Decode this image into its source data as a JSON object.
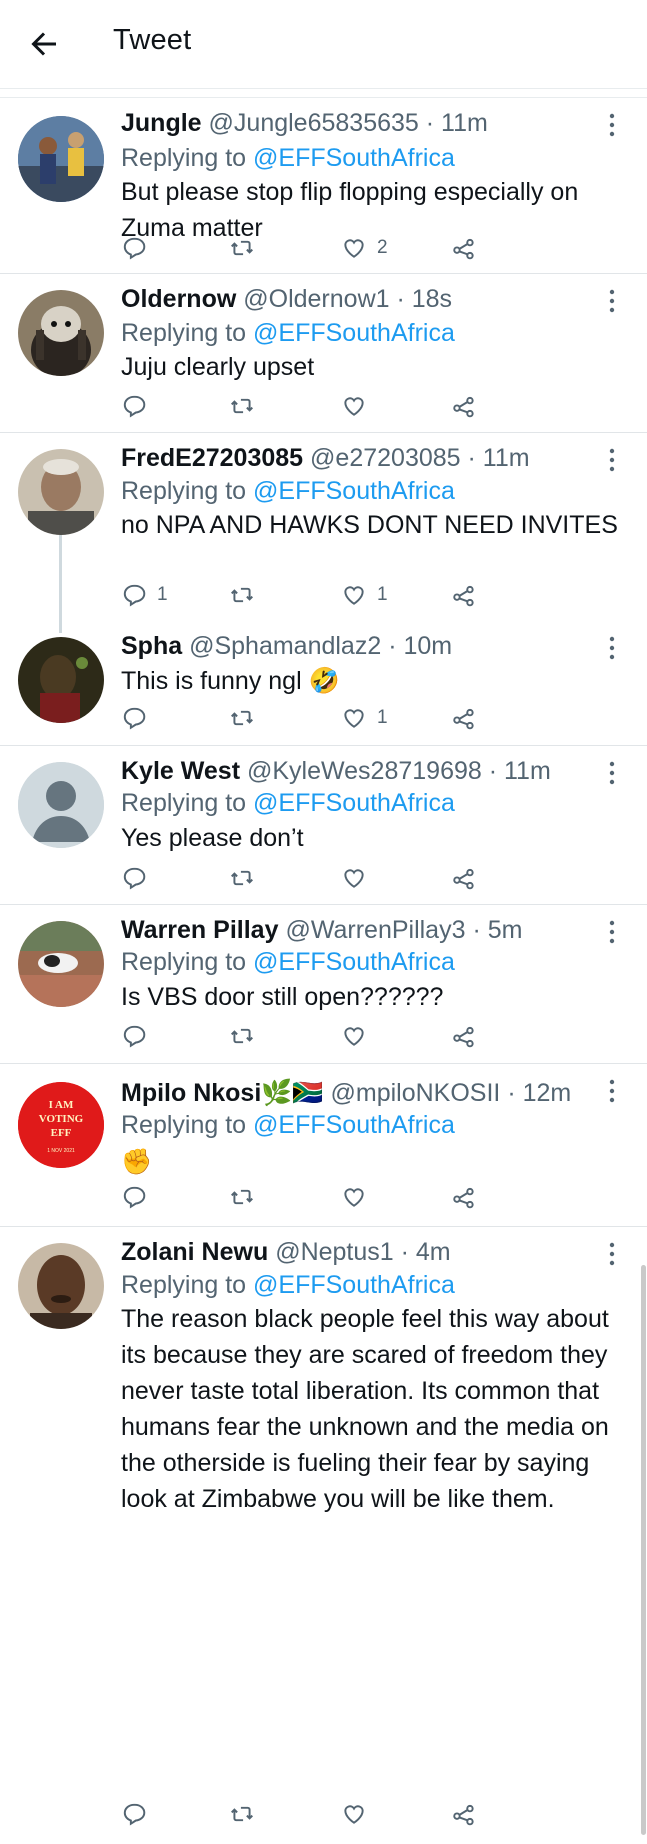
{
  "header": {
    "title": "Tweet"
  },
  "tweets": [
    {
      "name": "Jungle",
      "handle": "@Jungle65835635",
      "sep": " · ",
      "time": "11m",
      "replying_prefix": "Replying to ",
      "replying_to": "@EFFSouthAfrica",
      "text": "But please stop flip flopping especially on Zuma matter",
      "replies": "",
      "retweets": "",
      "likes": "2"
    },
    {
      "name": "Oldernow",
      "handle": "@Oldernow1",
      "sep": " · ",
      "time": "18s",
      "replying_prefix": "Replying to ",
      "replying_to": "@EFFSouthAfrica",
      "text": "Juju clearly upset",
      "replies": "",
      "retweets": "",
      "likes": ""
    },
    {
      "name": "FredE27203085",
      "handle": "@e27203085",
      "sep": " · ",
      "time": "11m",
      "replying_prefix": "Replying to ",
      "replying_to": "@EFFSouthAfrica",
      "text": "no NPA AND HAWKS DONT NEED INVITES",
      "replies": "1",
      "retweets": "",
      "likes": "1"
    },
    {
      "name": "Spha",
      "handle": "@Sphamandlaz2",
      "sep": " · ",
      "time": "10m",
      "replying_prefix": "",
      "replying_to": "",
      "text": "This is funny ngl 🤣",
      "replies": "",
      "retweets": "",
      "likes": "1"
    },
    {
      "name": "Kyle West",
      "handle": "@KyleWes28719698",
      "sep": " · ",
      "time": "11m",
      "replying_prefix": "Replying to ",
      "replying_to": "@EFFSouthAfrica",
      "text": "Yes please don’t",
      "replies": "",
      "retweets": "",
      "likes": ""
    },
    {
      "name": "Warren Pillay",
      "handle": "@WarrenPillay3",
      "sep": " · ",
      "time": "5m",
      "replying_prefix": "Replying to ",
      "replying_to": "@EFFSouthAfrica",
      "text": "Is VBS door still open??????",
      "replies": "",
      "retweets": "",
      "likes": ""
    },
    {
      "name": "Mpilo Nkosi🌿🇿🇦",
      "handle": "@mpiloNKOSII",
      "sep": " · ",
      "time": "12m",
      "replying_prefix": "Replying to ",
      "replying_to": "@EFFSouthAfrica",
      "text": "✊",
      "replies": "",
      "retweets": "",
      "likes": "",
      "avatar_text": [
        "I AM",
        "VOTING",
        "EFF",
        "1 NOV 2021"
      ]
    },
    {
      "name": "Zolani Newu",
      "handle": "@Neptus1",
      "sep": " · ",
      "time": "4m",
      "replying_prefix": "Replying to ",
      "replying_to": "@EFFSouthAfrica",
      "text": "The reason black people feel this way about its because they are scared of freedom they never taste total liberation. Its common that humans fear the unknown and the media on the otherside is fueling their fear by saying look at Zimbabwe you will be like them.",
      "replies": "",
      "retweets": "",
      "likes": ""
    }
  ],
  "icons": {
    "back": "arrow-left-icon",
    "more": "more-vertical-icon",
    "reply": "reply-icon",
    "retweet": "retweet-icon",
    "like": "heart-icon",
    "share": "share-icon"
  },
  "colors": {
    "link": "#1d9bf0",
    "secondary": "#536471",
    "text": "#0f1419",
    "divider": "#e1e5e8"
  }
}
